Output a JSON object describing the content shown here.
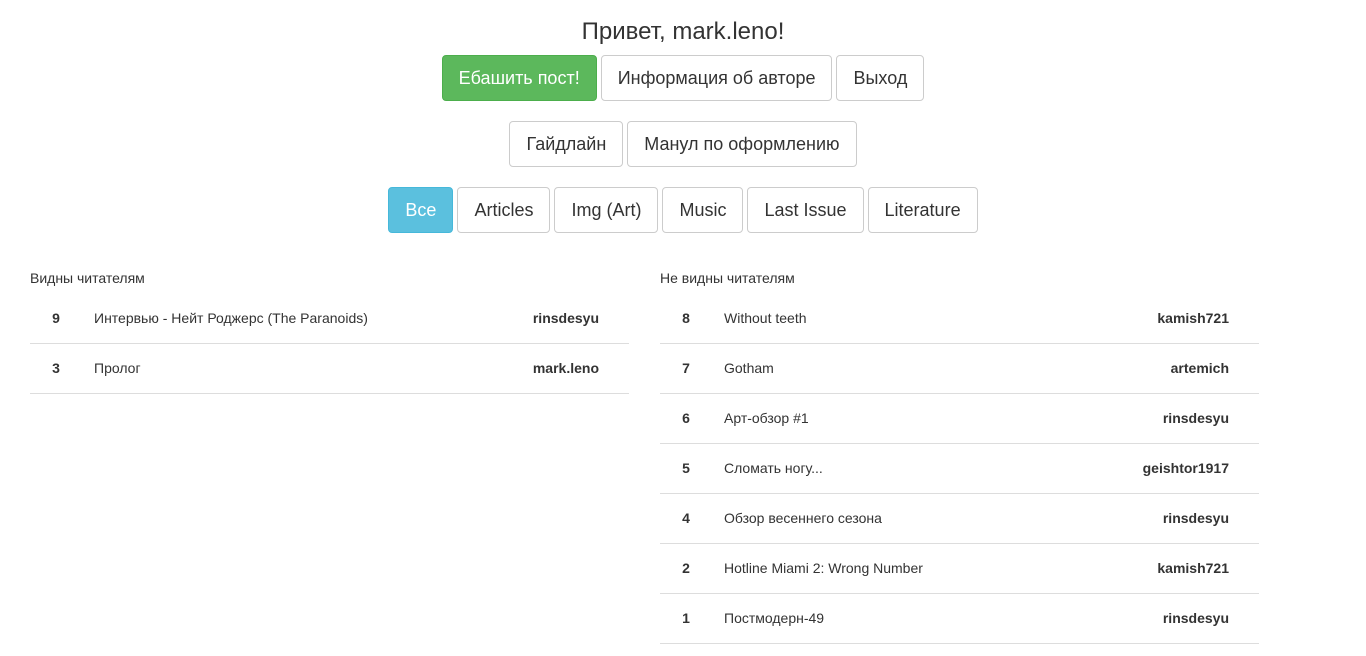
{
  "header": {
    "greeting": "Привет, mark.leno!"
  },
  "actions": {
    "post": "Ебашить пост!",
    "author_info": "Информация об авторе",
    "logout": "Выход"
  },
  "docs": {
    "guideline": "Гайдлайн",
    "manual": "Манул по оформлению"
  },
  "filters": {
    "all": "Все",
    "articles": "Articles",
    "img": "Img (Art)",
    "music": "Music",
    "last_issue": "Last Issue",
    "literature": "Literature",
    "active": "Все"
  },
  "colors": {
    "success": "#5cb85c",
    "info": "#5bc0de"
  },
  "visible": {
    "title": "Видны читателям",
    "rows": [
      {
        "num": "9",
        "title": "Интервью - Нейт Роджерс (The Paranoids)",
        "author": "rinsdesyu"
      },
      {
        "num": "3",
        "title": "Пролог",
        "author": "mark.leno"
      }
    ]
  },
  "hidden": {
    "title": "Не видны читателям",
    "rows": [
      {
        "num": "8",
        "title": "Without teeth",
        "author": "kamish721"
      },
      {
        "num": "7",
        "title": "Gotham",
        "author": "artemich"
      },
      {
        "num": "6",
        "title": "Арт-обзор #1",
        "author": "rinsdesyu"
      },
      {
        "num": "5",
        "title": "Сломать ногу...",
        "author": "geishtor1917"
      },
      {
        "num": "4",
        "title": "Обзор весеннего сезона",
        "author": "rinsdesyu"
      },
      {
        "num": "2",
        "title": "Hotline Miami 2: Wrong Number",
        "author": "kamish721"
      },
      {
        "num": "1",
        "title": "Постмодерн-49",
        "author": "rinsdesyu"
      }
    ]
  }
}
